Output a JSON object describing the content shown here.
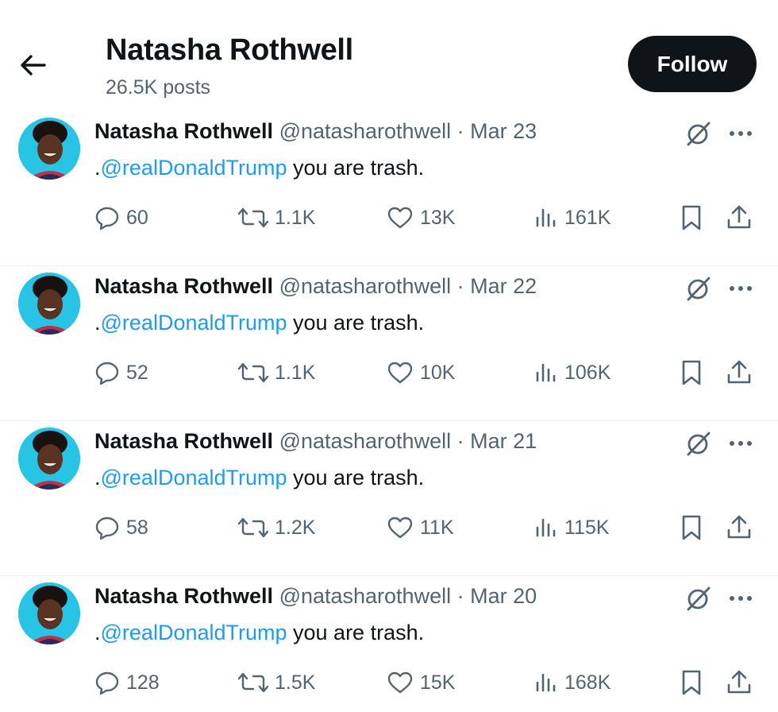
{
  "header": {
    "title": "Natasha Rothwell",
    "posts_count": "26.5K posts",
    "follow_label": "Follow"
  },
  "tweets": [
    {
      "name": "Natasha Rothwell",
      "handle": "@natasharothwell",
      "separator": "·",
      "date": "Mar 23",
      "text_prefix": ".",
      "mention": "@realDonaldTrump",
      "text_rest": " you are trash.",
      "replies": "60",
      "retweets": "1.1K",
      "likes": "13K",
      "views": "161K"
    },
    {
      "name": "Natasha Rothwell",
      "handle": "@natasharothwell",
      "separator": "·",
      "date": "Mar 22",
      "text_prefix": ".",
      "mention": "@realDonaldTrump",
      "text_rest": " you are trash.",
      "replies": "52",
      "retweets": "1.1K",
      "likes": "10K",
      "views": "106K"
    },
    {
      "name": "Natasha Rothwell",
      "handle": "@natasharothwell",
      "separator": "·",
      "date": "Mar 21",
      "text_prefix": ".",
      "mention": "@realDonaldTrump",
      "text_rest": " you are trash.",
      "replies": "58",
      "retweets": "1.2K",
      "likes": "11K",
      "views": "115K"
    },
    {
      "name": "Natasha Rothwell",
      "handle": "@natasharothwell",
      "separator": "·",
      "date": "Mar 20",
      "text_prefix": ".",
      "mention": "@realDonaldTrump",
      "text_rest": " you are trash.",
      "replies": "128",
      "retweets": "1.5K",
      "likes": "15K",
      "views": "168K"
    }
  ],
  "icons": {
    "back": "arrow-left-icon",
    "grok": "grok-icon",
    "more": "more-horizontal-icon",
    "reply": "reply-icon",
    "retweet": "retweet-icon",
    "like": "heart-icon",
    "views": "views-chart-icon",
    "bookmark": "bookmark-icon",
    "share": "share-icon"
  },
  "colors": {
    "text_primary": "#0f1419",
    "text_secondary": "#536471",
    "mention": "#1d9bf0",
    "follow_bg": "#0f1419",
    "avatar_bg": "#27c4e6"
  }
}
